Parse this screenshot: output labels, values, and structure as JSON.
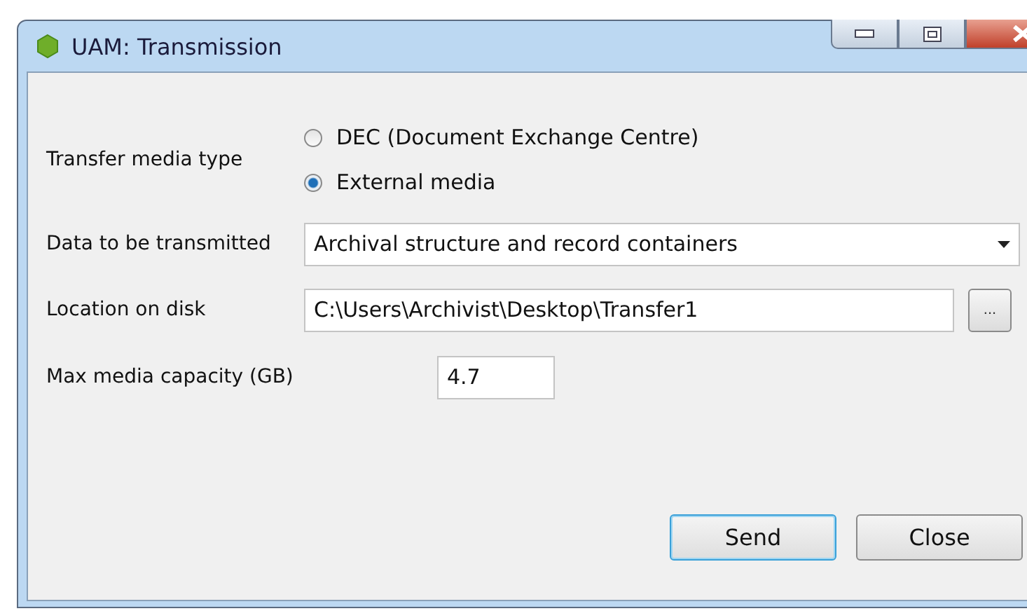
{
  "window": {
    "title": "UAM: Transmission"
  },
  "transfer_media_type": {
    "label": "Transfer media type",
    "options": [
      {
        "label": "DEC (Document Exchange Centre)",
        "selected": false
      },
      {
        "label": "External media",
        "selected": true
      }
    ]
  },
  "data_to_transmit": {
    "label": "Data to be transmitted",
    "value": "Archival structure and record containers"
  },
  "location": {
    "label": "Location on disk",
    "value": "C:\\Users\\Archivist\\Desktop\\Transfer1",
    "browse": "..."
  },
  "capacity": {
    "label": "Max media capacity (GB)",
    "value": "4.7"
  },
  "buttons": [
    {
      "label": "Send",
      "selected": true
    },
    {
      "label": "Close",
      "selected": false
    }
  ]
}
